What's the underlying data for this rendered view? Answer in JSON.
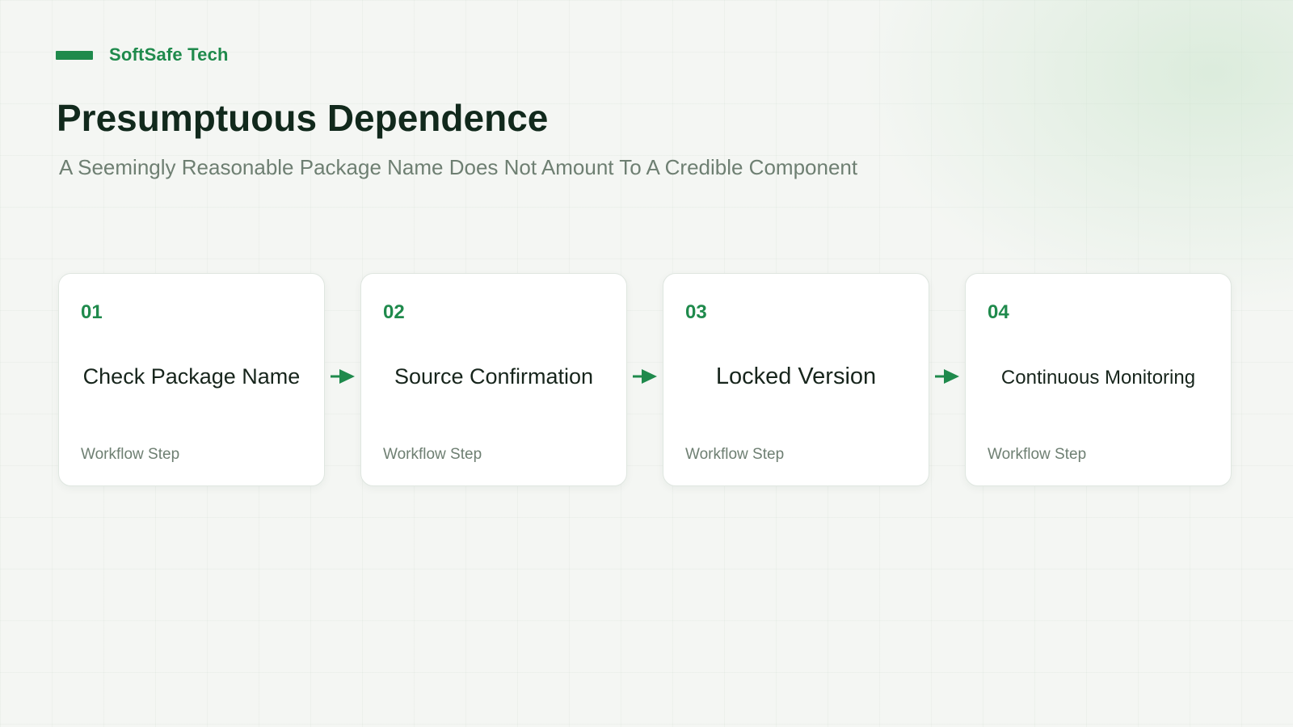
{
  "brand": {
    "name": "SoftSafe Tech",
    "accent_color": "#1f8a4c"
  },
  "title": "Presumptuous Dependence",
  "subtitle": "A Seemingly Reasonable Package Name Does Not Amount To A Credible Component",
  "steps": [
    {
      "number": "01",
      "title": "Check Package Name",
      "caption": "Workflow Step"
    },
    {
      "number": "02",
      "title": "Source Confirmation",
      "caption": "Workflow Step"
    },
    {
      "number": "03",
      "title": "Locked Version",
      "caption": "Workflow Step"
    },
    {
      "number": "04",
      "title": "Continuous Monitoring",
      "caption": "Workflow Step"
    }
  ],
  "connector_icon": "arrow-right-icon"
}
